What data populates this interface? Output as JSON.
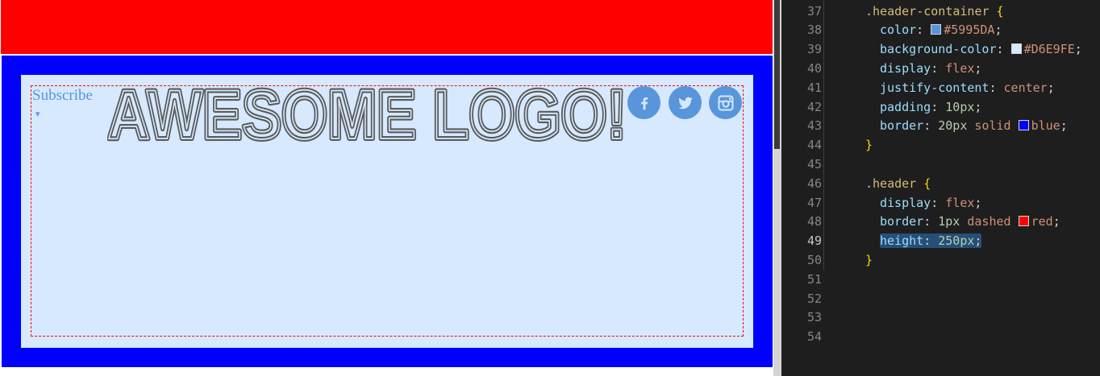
{
  "preview": {
    "subscribe_label": "Subscribe",
    "subscribe_arrow": "▾",
    "logo_text": "AWESOME LOGO!",
    "social_icons": [
      "facebook-icon",
      "twitter-icon",
      "instagram-icon"
    ],
    "colors": {
      "top_bar": "#ff0000",
      "container_border": "#0000ff",
      "container_background": "#d6e9fe",
      "accent": "#5995da",
      "header_border": "#ff0000",
      "logo": "#5a5a5a"
    }
  },
  "editor": {
    "lines": [
      {
        "num": "37",
        "indent": 0,
        "selector": ".header-container",
        "brace": " {"
      },
      {
        "num": "38",
        "indent": 1,
        "prop": "color",
        "swatch": "#5995DA",
        "value": "#5995DA"
      },
      {
        "num": "39",
        "indent": 1,
        "prop": "background-color",
        "swatch": "#D6E9FE",
        "value": "#D6E9FE"
      },
      {
        "num": "40",
        "indent": 1,
        "prop": "display",
        "value": "flex"
      },
      {
        "num": "41",
        "indent": 1,
        "prop": "justify-content",
        "value": "center"
      },
      {
        "num": "42",
        "indent": 1,
        "prop": "padding",
        "value": "10px"
      },
      {
        "num": "43",
        "indent": 1,
        "prop": "border",
        "value": "20px solid ",
        "swatch_after": "#0000FF",
        "value2": "blue"
      },
      {
        "num": "44",
        "indent": 0,
        "brace": "}"
      },
      {
        "num": "45",
        "indent": 0
      },
      {
        "num": "46",
        "indent": 0,
        "selector": ".header",
        "brace": " {"
      },
      {
        "num": "47",
        "indent": 1,
        "prop": "display",
        "value": "flex"
      },
      {
        "num": "48",
        "indent": 1,
        "prop": "border",
        "value": "1px dashed ",
        "swatch_after": "#FF0000",
        "value2": "red"
      },
      {
        "num": "49",
        "indent": 1,
        "prop": "height",
        "value": "250px",
        "selected": true,
        "active": true
      },
      {
        "num": "50",
        "indent": 0,
        "brace": "}"
      },
      {
        "num": "51",
        "indent": 0
      },
      {
        "num": "52",
        "indent": 0
      },
      {
        "num": "53",
        "indent": 0
      },
      {
        "num": "54",
        "indent": 0
      }
    ],
    "colors": {
      "background": "#1e1e1e",
      "line_number": "#858585",
      "selector": "#d7ba7d",
      "property": "#9cdcfe",
      "value": "#ce9178",
      "selection": "#264f78"
    }
  }
}
